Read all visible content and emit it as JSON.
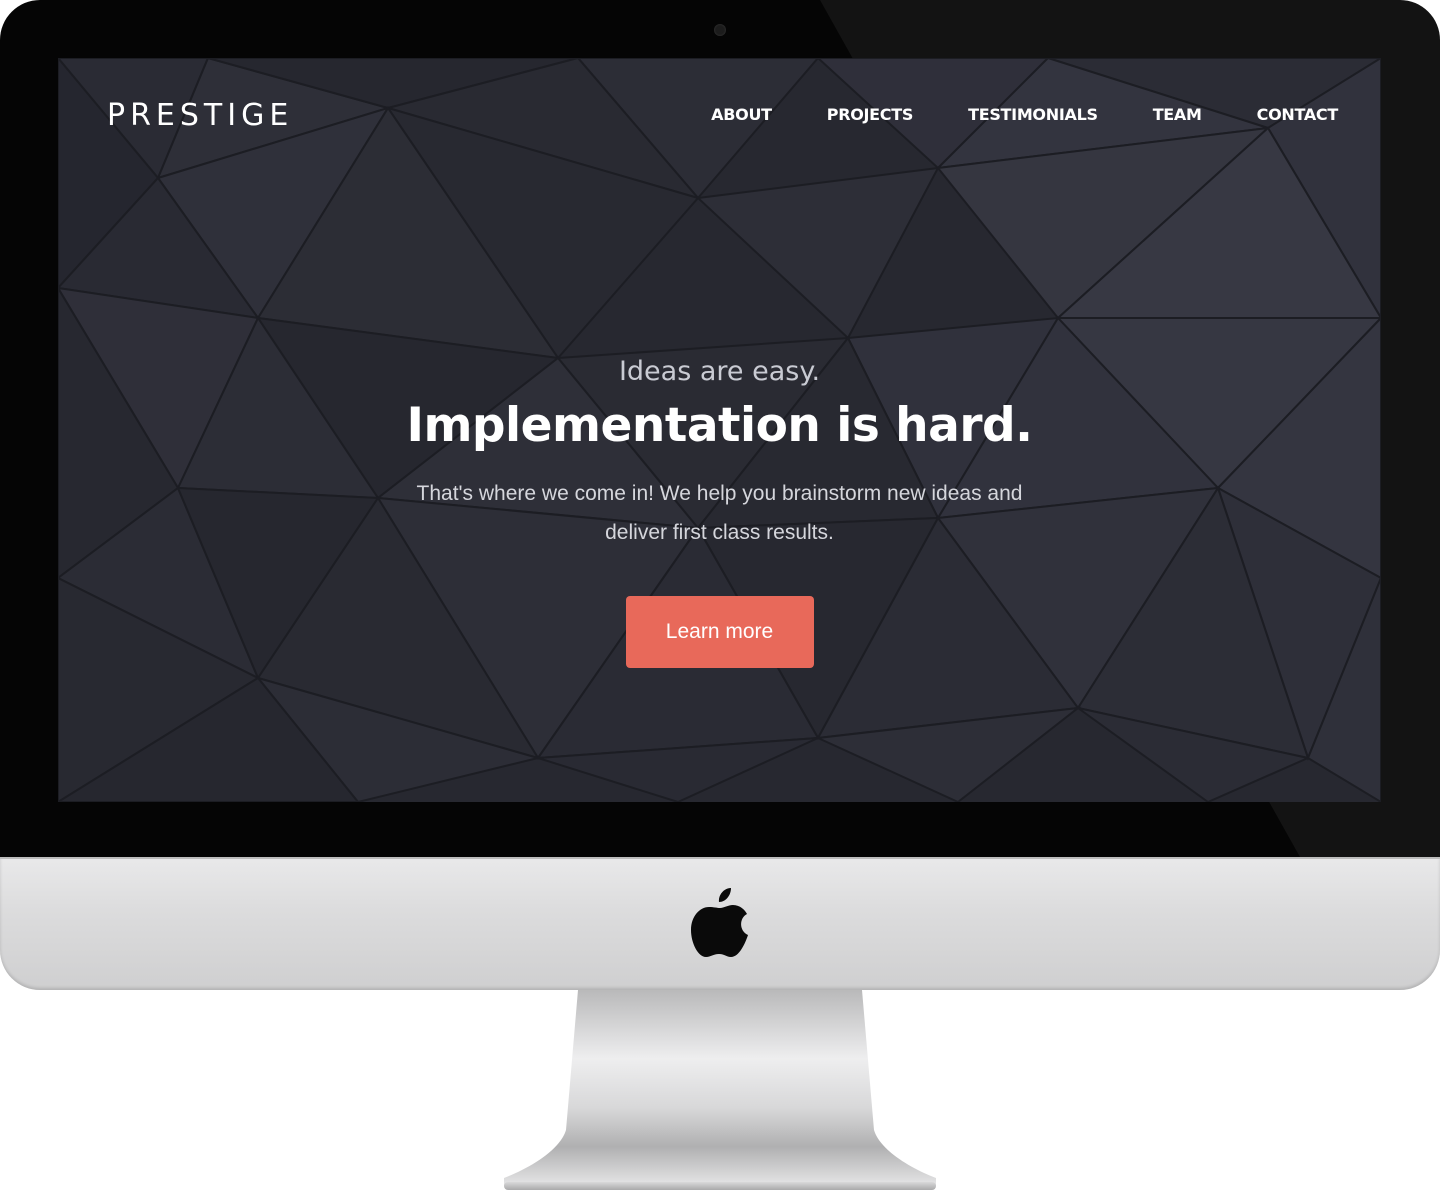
{
  "site": {
    "logo": "PRESTIGE",
    "nav": [
      {
        "label": "ABOUT"
      },
      {
        "label": "PROJECTS"
      },
      {
        "label": "TESTIMONIALS"
      },
      {
        "label": "TEAM"
      },
      {
        "label": "CONTACT"
      }
    ]
  },
  "hero": {
    "kicker": "Ideas are easy.",
    "title": "Implementation is hard.",
    "body": "That's where we come in! We help you brainstorm new ideas and deliver first class results.",
    "cta_label": "Learn more"
  },
  "colors": {
    "background": "#2b2c35",
    "accent": "#e8695a",
    "text": "#ffffff"
  },
  "icons": {
    "brand": "apple-logo-icon",
    "camera": "camera-icon"
  }
}
